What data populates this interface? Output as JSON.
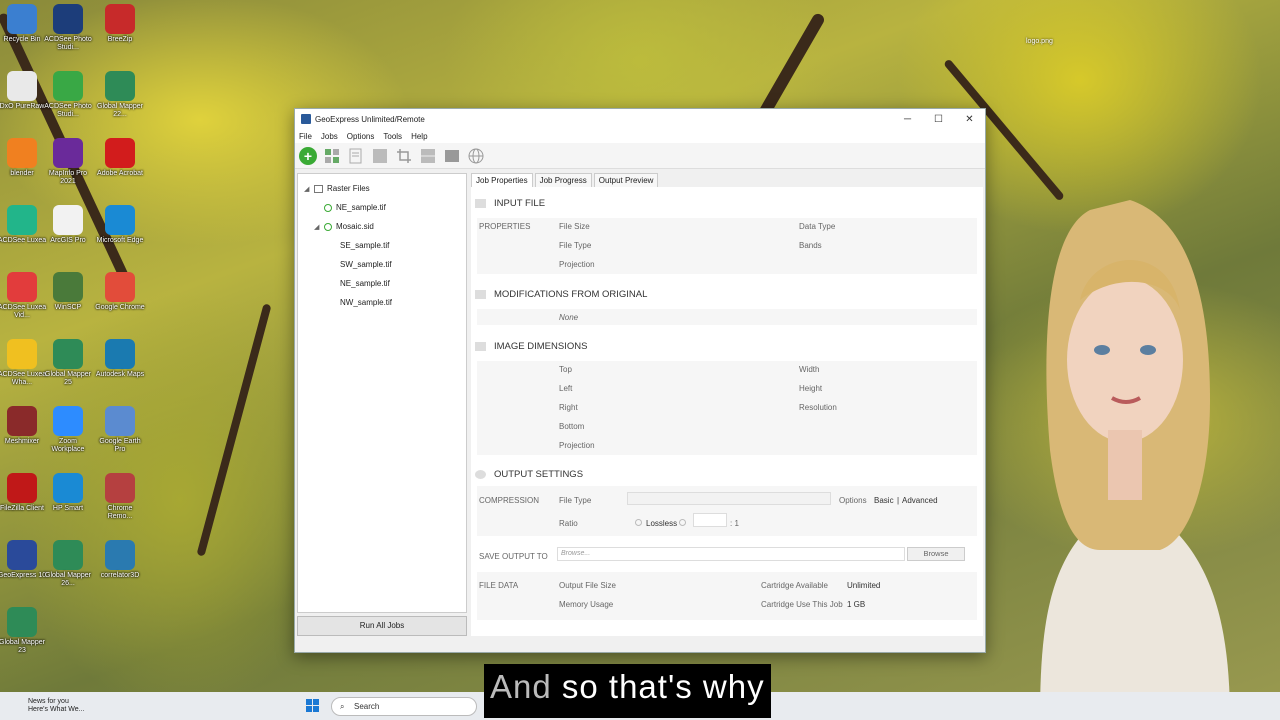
{
  "desktop_icons": [
    {
      "label": "Recycle Bin",
      "color": "#3b7fd0"
    },
    {
      "label": "ACDSee Photo Studi...",
      "color": "#1c3d7a"
    },
    {
      "label": "BreeZip",
      "color": "#c72a2a"
    },
    {
      "label": "DxO PureRaw",
      "color": "#e9e9e9"
    },
    {
      "label": "ACDSee Photo Studi...",
      "color": "#39a845"
    },
    {
      "label": "Global Mapper 22...",
      "color": "#2e8b57"
    },
    {
      "label": "blender",
      "color": "#f08020"
    },
    {
      "label": "MapInfo Pro 2021",
      "color": "#6a2a9a"
    },
    {
      "label": "Adobe Acrobat",
      "color": "#d21c1c"
    },
    {
      "label": "ACDSee Luxea",
      "color": "#22b58a"
    },
    {
      "label": "ArcGIS Pro",
      "color": "#f2f2f2"
    },
    {
      "label": "Microsoft Edge",
      "color": "#1a8ad4"
    },
    {
      "label": "ACDSee Luxea Vid...",
      "color": "#e23c3c"
    },
    {
      "label": "WinSCP",
      "color": "#4a7a3a"
    },
    {
      "label": "Google Chrome",
      "color": "#e24c3a"
    },
    {
      "label": "ACDSee Luxea Wha...",
      "color": "#f0c020"
    },
    {
      "label": "Global Mapper 25",
      "color": "#2e8b57"
    },
    {
      "label": "Autodesk Maps",
      "color": "#1a7ab0"
    },
    {
      "label": "Meshmixer",
      "color": "#8a2a2a"
    },
    {
      "label": "Zoom Workplace",
      "color": "#2d8cff"
    },
    {
      "label": "Google Earth Pro",
      "color": "#5b8bd0"
    },
    {
      "label": "FileZilla Client",
      "color": "#c01818"
    },
    {
      "label": "HP Smart",
      "color": "#1a8ad4"
    },
    {
      "label": "Chrome Remo...",
      "color": "#b54040"
    },
    {
      "label": "GeoExpress 10",
      "color": "#2a4a9a"
    },
    {
      "label": "Global Mapper 26...",
      "color": "#2e8b57"
    },
    {
      "label": "correlator3D",
      "color": "#2a7ab0"
    },
    {
      "label": "Global Mapper 23",
      "color": "#2e8b57"
    }
  ],
  "desktop_right_label": "logo.png",
  "window": {
    "title": "GeoExpress Unlimited/Remote",
    "controls": {
      "min": "─",
      "max": "☐",
      "close": "✕"
    },
    "menu": [
      "File",
      "Jobs",
      "Options",
      "Tools",
      "Help"
    ],
    "toolbar_icons": [
      "add-icon",
      "mosaic-icon",
      "document-icon",
      "grid-icon",
      "crop-icon",
      "tiles-icon",
      "image-icon",
      "globe-icon"
    ],
    "tree": {
      "root": "Raster Files",
      "items": [
        {
          "label": "NE_sample.tif",
          "level": 1,
          "status": "ok"
        },
        {
          "label": "Mosaic.sid",
          "level": 1,
          "status": "ok",
          "expanded": true
        },
        {
          "label": "SE_sample.tif",
          "level": 2
        },
        {
          "label": "SW_sample.tif",
          "level": 2
        },
        {
          "label": "NE_sample.tif",
          "level": 2
        },
        {
          "label": "NW_sample.tif",
          "level": 2
        }
      ]
    },
    "run_all": "Run All Jobs",
    "tabs": [
      "Job Properties",
      "Job Progress",
      "Output Preview"
    ],
    "input_file": {
      "heading": "INPUT FILE",
      "properties_label": "PROPERTIES",
      "file_size": "File Size",
      "file_type": "File Type",
      "projection": "Projection",
      "data_type": "Data Type",
      "bands": "Bands"
    },
    "modifications": {
      "heading": "MODIFICATIONS FROM ORIGINAL",
      "value": "None"
    },
    "dimensions": {
      "heading": "IMAGE DIMENSIONS",
      "top": "Top",
      "left": "Left",
      "right": "Right",
      "bottom": "Bottom",
      "projection": "Projection",
      "width": "Width",
      "height": "Height",
      "resolution": "Resolution"
    },
    "output": {
      "heading": "OUTPUT SETTINGS",
      "compression": "COMPRESSION",
      "file_type": "File Type",
      "ratio": "Ratio",
      "lossless": "Lossless",
      "ratio_suffix": ": 1",
      "options": "Options",
      "basic": "Basic",
      "sep": "|",
      "advanced": "Advanced",
      "save_to": "SAVE OUTPUT TO",
      "browse_placeholder": "Browse...",
      "browse_btn": "Browse",
      "file_data": "FILE DATA",
      "output_file_size": "Output File Size",
      "memory_usage": "Memory Usage",
      "cartridge_available": "Cartridge Available",
      "cartridge_available_val": "Unlimited",
      "cartridge_use": "Cartridge Use This Job",
      "cartridge_use_val": "1 GB"
    }
  },
  "taskbar": {
    "news_title": "News for you",
    "news_sub": "Here's What We...",
    "search_placeholder": "Search"
  },
  "caption": {
    "dim": "And",
    "text": " so that's why"
  }
}
